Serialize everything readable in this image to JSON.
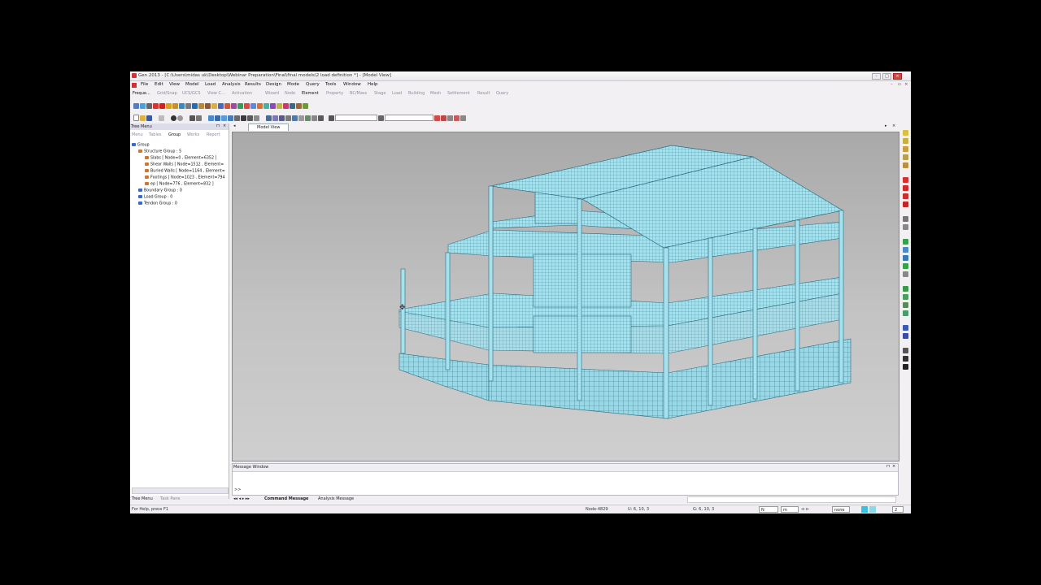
{
  "window": {
    "title": "Gen 2013 - [C:\\Users\\midas uk\\Desktop\\Webinar Preparation\\Final\\final models\\2 load definition *] - [Model View]"
  },
  "menubar": {
    "items": [
      "File",
      "Edit",
      "View",
      "Model",
      "Load",
      "Analysis",
      "Results",
      "Design",
      "Mode",
      "Query",
      "Tools",
      "Window",
      "Help"
    ]
  },
  "ribbon": {
    "tabs": [
      "Freque...",
      "Grid/Snap",
      "UCS/GCS",
      "View C...",
      "Activation",
      "Wizard",
      "Node",
      "Element",
      "Property",
      "BC/Mass",
      "Stage",
      "Load",
      "Building",
      "Mesh",
      "Settlement",
      "Result",
      "Query"
    ],
    "active": "Element"
  },
  "toolbar": {
    "combo1": "",
    "combo2": ""
  },
  "left_panel": {
    "title": "Tree Menu",
    "tabs": [
      "Menu",
      "Tables",
      "Group",
      "Works",
      "Report"
    ],
    "active_tab": "Group",
    "tree": [
      {
        "label": "Group",
        "level": 0,
        "icon": "group-icon"
      },
      {
        "label": "Structure Group : 5",
        "level": 1,
        "icon": "folder-icon"
      },
      {
        "label": "Slabs [ Node=0 , Element=6352 ]",
        "level": 2,
        "icon": "structure-group-icon"
      },
      {
        "label": "Shear Walls [ Node=1512 , Element=",
        "level": 2,
        "icon": "structure-group-icon"
      },
      {
        "label": "Buried Walls [ Node=1164 , Element=",
        "level": 2,
        "icon": "structure-group-icon"
      },
      {
        "label": "Footings [ Node=1023 , Element=794",
        "level": 2,
        "icon": "structure-group-icon"
      },
      {
        "label": "ep [ Node=776 , Element=832 ]",
        "level": 2,
        "icon": "structure-group-icon"
      },
      {
        "label": "Boundary Group : 0",
        "level": 1,
        "icon": "boundary-group-icon"
      },
      {
        "label": "Load Group : 0",
        "level": 1,
        "icon": "load-group-icon"
      },
      {
        "label": "Tendon Group : 0",
        "level": 1,
        "icon": "tendon-group-icon"
      }
    ],
    "bottom_tabs": [
      "Tree Menu",
      "Task Pane"
    ]
  },
  "view": {
    "tab_label": "Model View"
  },
  "message_window": {
    "title": "Message Window",
    "prompt": ">>",
    "tabs": [
      "Command Message",
      "Analysis Message"
    ]
  },
  "status_bar": {
    "help": "For Help, press F1",
    "node": "Node-4829",
    "ucs": "U: 6, 10, 3",
    "gcs": "G: 6, 10, 3",
    "force_unit": "N",
    "length_unit": "m",
    "display": "none",
    "page": "2"
  }
}
